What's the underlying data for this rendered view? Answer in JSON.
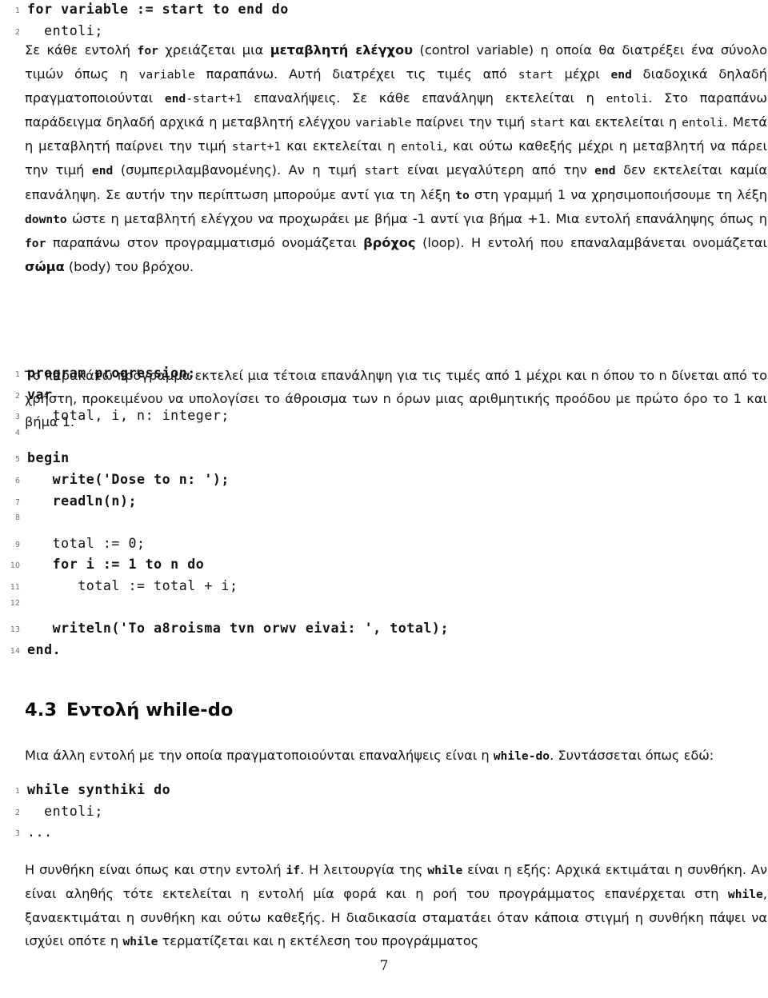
{
  "page": {
    "folio": "7",
    "language": "el"
  },
  "listing_for": {
    "name": "for-syntax-listing",
    "lines": [
      {
        "n": "1",
        "text": "for variable := start to end do",
        "bold": true
      },
      {
        "n": "2",
        "text": "  entoli;",
        "bold": false
      }
    ]
  },
  "paragraph_for_1": {
    "runs": [
      {
        "t": "Σε κάθε εντολή ",
        "s": "normal"
      },
      {
        "t": "for",
        "s": "mono-bold"
      },
      {
        "t": " χρειάζεται μια ",
        "s": "normal"
      },
      {
        "t": "μεταβλητή ελέγχου",
        "s": "bold"
      },
      {
        "t": " (control variable) η οποία θα διατρέξει ένα σύνολο τιμών όπως η ",
        "s": "normal"
      },
      {
        "t": "variable",
        "s": "mono"
      },
      {
        "t": " παραπάνω. Αυτή διατρέχει τις τιμές από ",
        "s": "normal"
      },
      {
        "t": "start",
        "s": "mono"
      },
      {
        "t": " μέχρι ",
        "s": "normal"
      },
      {
        "t": "end",
        "s": "mono-bold"
      },
      {
        "t": " διαδοχικά δηλαδή πραγματοποιούνται ",
        "s": "normal"
      },
      {
        "t": "end",
        "s": "mono-bold"
      },
      {
        "t": "-start+1",
        "s": "mono"
      },
      {
        "t": " επαναλήψεις. Σε κάθε επανάληψη εκτελείται η ",
        "s": "normal"
      },
      {
        "t": "entoli",
        "s": "mono"
      },
      {
        "t": ". Στο παραπάνω παράδειγμα δηλαδή αρχικά η μεταβλητή ελέγχου ",
        "s": "normal"
      },
      {
        "t": "variable",
        "s": "mono"
      },
      {
        "t": " παίρνει την τιμή ",
        "s": "normal"
      },
      {
        "t": "start",
        "s": "mono"
      },
      {
        "t": " και εκτελείται η ",
        "s": "normal"
      },
      {
        "t": "entoli",
        "s": "mono"
      },
      {
        "t": ". Μετά η μεταβλητή παίρνει την τιμή ",
        "s": "normal"
      },
      {
        "t": "start+1",
        "s": "mono"
      },
      {
        "t": " και εκτελείται η ",
        "s": "normal"
      },
      {
        "t": "entoli",
        "s": "mono"
      },
      {
        "t": ", και ούτω καθεξής μέχρι η μεταβλητή να πάρει την τιμή ",
        "s": "normal"
      },
      {
        "t": "end",
        "s": "mono-bold"
      },
      {
        "t": " (συμπεριλαμβανομένης). Αν η τιμή ",
        "s": "normal"
      },
      {
        "t": "start",
        "s": "mono"
      },
      {
        "t": " είναι μεγαλύτερη από την ",
        "s": "normal"
      },
      {
        "t": "end",
        "s": "mono-bold"
      },
      {
        "t": " δεν εκτελείται καμία επανάληψη. Σε αυτήν την περίπτωση μπορούμε αντί για τη λέξη ",
        "s": "normal"
      },
      {
        "t": "to",
        "s": "mono-bold"
      },
      {
        "t": " στη γραμμή 1 να χρησιμοποιήσουμε τη λέξη ",
        "s": "normal"
      },
      {
        "t": "downto",
        "s": "mono-bold"
      },
      {
        "t": " ώστε η μεταβλητή ελέγχου να προχωράει με βήμα -1 αντί για βήμα +1. Μια εντολή επανάληψης όπως η ",
        "s": "normal"
      },
      {
        "t": "for",
        "s": "mono-bold"
      },
      {
        "t": " παραπάνω στον προγραμματισμό ονομάζεται ",
        "s": "normal"
      },
      {
        "t": "βρόχος",
        "s": "bold"
      },
      {
        "t": " (loop). Η εντολή που επαναλαμβάνεται ονομάζεται ",
        "s": "normal"
      },
      {
        "t": "σώμα",
        "s": "bold"
      },
      {
        "t": " (body) του βρόχου.",
        "s": "normal"
      }
    ]
  },
  "paragraph_for_2": {
    "runs": [
      {
        "t": "Το παρακάτω πρόγραμμα εκτελεί μια τέτοια επανάληψη για τις τιμές από 1 μέχρι και n όπου το n δίνεται από το χρήστη, προκειμένου να υπολογίσει το άθροισμα των n όρων μιας αριθμητικής προόδου με πρώτο όρο το 1 και βήμα 1.",
        "s": "normal"
      }
    ]
  },
  "listing_program": {
    "name": "progression-program-listing",
    "lines": [
      {
        "n": "1",
        "text": "program progression;",
        "bold": true
      },
      {
        "n": "2",
        "text": "var",
        "bold": true
      },
      {
        "n": "3",
        "text": "   total, i, n: integer;",
        "bold": false
      },
      {
        "n": "4",
        "text": "",
        "bold": false
      },
      {
        "n": "5",
        "text": "begin",
        "bold": true
      },
      {
        "n": "6",
        "text": "   write('Dose to n: ');",
        "bold": true
      },
      {
        "n": "7",
        "text": "   readln(n);",
        "bold": true
      },
      {
        "n": "8",
        "text": "",
        "bold": false
      },
      {
        "n": "9",
        "text": "   total := 0;",
        "bold": false
      },
      {
        "n": "10",
        "text": "   for i := 1 to n do",
        "bold": true
      },
      {
        "n": "11",
        "text": "      total := total + i;",
        "bold": false
      },
      {
        "n": "12",
        "text": "",
        "bold": false
      },
      {
        "n": "13",
        "text": "   writeln('To a8roisma tvn orwv eivai: ', total);",
        "bold": true
      },
      {
        "n": "14",
        "text": "end.",
        "bold": true
      }
    ]
  },
  "heading_while": {
    "number": "4.3",
    "title": "Εντολή while-do"
  },
  "paragraph_while_intro": {
    "runs": [
      {
        "t": "Μια άλλη εντολή με την οποία πραγματοποιούνται επαναλήψεις είναι η ",
        "s": "normal"
      },
      {
        "t": "while-do",
        "s": "mono-bold"
      },
      {
        "t": ". Συντάσσεται όπως εδώ:",
        "s": "normal"
      }
    ]
  },
  "listing_while": {
    "name": "while-syntax-listing",
    "lines": [
      {
        "n": "1",
        "text": "while synthiki do",
        "bold": true
      },
      {
        "n": "2",
        "text": "  entoli;",
        "bold": false
      },
      {
        "n": "3",
        "text": "...",
        "bold": false
      }
    ]
  },
  "paragraph_while_body": {
    "runs": [
      {
        "t": "Η συνθήκη είναι όπως και στην εντολή ",
        "s": "normal"
      },
      {
        "t": "if",
        "s": "mono-bold"
      },
      {
        "t": ". Η λειτουργία της ",
        "s": "normal"
      },
      {
        "t": "while",
        "s": "mono-bold"
      },
      {
        "t": " είναι η εξής: Αρχικά εκτιμάται η συνθήκη. Αν είναι αληθής τότε εκτελείται η εντολή μία φορά και η ροή του προγράμματος επανέρχεται στη ",
        "s": "normal"
      },
      {
        "t": "while",
        "s": "mono-bold"
      },
      {
        "t": ", ξαναεκτιμάται η συνθήκη και ούτω καθεξής. Η διαδικασία σταματάει όταν κάποια στιγμή η συνθήκη πάψει να ισχύει οπότε η ",
        "s": "normal"
      },
      {
        "t": "while",
        "s": "mono-bold"
      },
      {
        "t": " τερματίζεται και η εκτέλεση του προγράμματος",
        "s": "normal"
      }
    ]
  }
}
